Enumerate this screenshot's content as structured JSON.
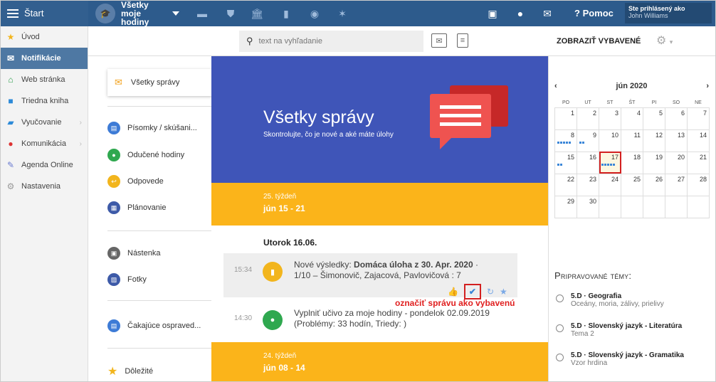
{
  "topbar": {
    "start_label": "Štart",
    "app_title": "Všetky moje hodiny",
    "help_label": "Pomoc",
    "user_caption": "Ste prihlásený ako",
    "user_name": "John Williams"
  },
  "sidebar": {
    "items": [
      {
        "label": "Úvod",
        "icon": "star-icon"
      },
      {
        "label": "Notifikácie",
        "icon": "mail-icon"
      },
      {
        "label": "Web stránka",
        "icon": "home-icon"
      },
      {
        "label": "Triedna kniha",
        "icon": "book-icon"
      },
      {
        "label": "Vyučovanie",
        "icon": "briefcase-icon"
      },
      {
        "label": "Komunikácia",
        "icon": "chat-icon"
      },
      {
        "label": "Agenda Online",
        "icon": "pen-icon"
      },
      {
        "label": "Nastavenia",
        "icon": "gear-icon"
      }
    ]
  },
  "toolbar": {
    "search_placeholder": "text na vyhľadanie",
    "show_selected": "ZOBRAZIŤ VYBAVENÉ"
  },
  "categories": {
    "selected": "Všetky správy",
    "items": [
      "Písomky / skúšani...",
      "Odučené hodiny",
      "Odpovede",
      "Plánovanie",
      "Nástenka",
      "Fotky",
      "Čakajúce ospraved...",
      "Dôležité"
    ]
  },
  "hero": {
    "title": "Všetky správy",
    "subtitle": "Skontrolujte, čo je nové a aké máte úlohy"
  },
  "weeks": [
    {
      "label": "25. týždeň",
      "range": "jún 15 - 21"
    },
    {
      "label": "24. týždeň",
      "range": "jún 08 - 14"
    }
  ],
  "day_heading": "Utorok 16.06.",
  "messages": [
    {
      "time": "15:34",
      "prefix": "Nové výsledky: ",
      "strong": "Domáca úloha z 30. Apr. 2020",
      "suffix": " · 1/10 – Šimonovič, Zajacová, Pavlovičová : 7"
    },
    {
      "time": "14:30",
      "text": "Vyplniť učivo za moje hodiny - pondelok 02.09.2019 (Problémy: 33 hodín, Triedy: )"
    }
  ],
  "annotation": "označiť správu ako vybavenú",
  "calendar": {
    "month": "jún 2020",
    "weekdays": [
      "PO",
      "UT",
      "ST",
      "ŠT",
      "PI",
      "SO",
      "NE"
    ],
    "weeks": [
      [
        "1",
        "2",
        "3",
        "4",
        "5",
        "6",
        "7"
      ],
      [
        "8",
        "9",
        "10",
        "11",
        "12",
        "13",
        "14"
      ],
      [
        "15",
        "16",
        "17",
        "18",
        "19",
        "20",
        "21"
      ],
      [
        "22",
        "23",
        "24",
        "25",
        "26",
        "27",
        "28"
      ],
      [
        "29",
        "30",
        "",
        "",
        "",
        "",
        ""
      ]
    ]
  },
  "topics": {
    "heading": "Pripravované témy:",
    "items": [
      {
        "title": "5.D · Geografia",
        "sub": "Oceány, moria, zálivy, prielivy"
      },
      {
        "title": "5.D · Slovenský jazyk - Literatúra",
        "sub": "Tema 2"
      },
      {
        "title": "5.D · Slovenský jazyk - Gramatika",
        "sub": "Vzor hrdina"
      }
    ]
  }
}
